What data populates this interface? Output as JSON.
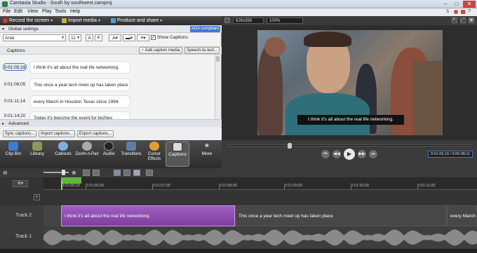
{
  "window": {
    "title": "Camtasia Studio - South by southwest.camproj"
  },
  "menu": {
    "items": [
      "File",
      "Edit",
      "View",
      "Play",
      "Tools",
      "Help"
    ],
    "right_info": "5"
  },
  "toolbar": {
    "record": "Record the screen",
    "import": "Import media",
    "share": "Produce and share"
  },
  "settings": {
    "global_label": "Global settings",
    "ada_label": "ADA compliant",
    "font": "Arial",
    "size": "11",
    "show_captions": "Show Captions",
    "captions_label": "Captions",
    "add_caption": "Add caption media",
    "speech_to_text": "Speech-to-text...",
    "advanced_label": "Advanced",
    "sync": "Sync captions...",
    "import_captions": "Import captions...",
    "export_captions": "Export captions..."
  },
  "captions": [
    {
      "time": "0:01:05;19",
      "text": "I think it's all about the real life networking.",
      "selected": true
    },
    {
      "time": "0:01:08;05",
      "text": "This once a year tech meet up has taken place",
      "selected": false
    },
    {
      "time": "0:01:11;14",
      "text": "every March in Houston Texas since 1994.",
      "selected": false
    },
    {
      "time": "0:01:14;20",
      "text": "Today it's become the event for techies",
      "selected": false
    }
  ],
  "preview": {
    "dimensions": "626x356",
    "zoom": "100%",
    "subtitle": "I think it's all about the real life networking.",
    "time_readout": "0:01:05;19 / 0:05:08;11",
    "playhead_fraction": 0.25
  },
  "tasks": [
    {
      "label": "Clip Bin",
      "icon": "clip-bin",
      "color": "#3f7bd1"
    },
    {
      "label": "Library",
      "icon": "library",
      "color": "#8a9a54"
    },
    {
      "label": "Callouts",
      "icon": "callouts",
      "color": "#7fb0e0"
    },
    {
      "label": "Zoom-n-Pan",
      "icon": "zoom",
      "color": "#aaaaaa"
    },
    {
      "label": "Audio",
      "icon": "audio",
      "color": "#222222"
    },
    {
      "label": "Transitions",
      "icon": "transitions",
      "color": "#5d7fa6"
    },
    {
      "label": "Cursor Effects",
      "icon": "cursor",
      "color": "#e0a030"
    },
    {
      "label": "Captions",
      "icon": "captions",
      "color": "#dddddd",
      "active": true
    },
    {
      "label": "More",
      "icon": "more",
      "color": "#bbbbbb"
    }
  ],
  "timeline": {
    "ticks": [
      "0:01:05;19",
      "0:01:06;00",
      "0:01:07;00",
      "0:01:08;00",
      "0:01:09;00",
      "0:01:10;00",
      "0:01:11;00"
    ],
    "track2_label": "Track 2",
    "track1_label": "Track 1",
    "clips": [
      {
        "text": "I think it's all about the real life networking.",
        "color": "#8e4fb0"
      },
      {
        "text": "This once a year tech meet up has taken place",
        "color": "#444444"
      },
      {
        "text": "every March",
        "color": "#444444"
      }
    ]
  }
}
